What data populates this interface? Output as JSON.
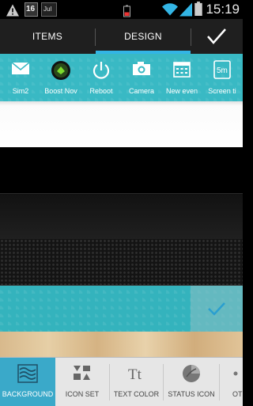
{
  "status_bar": {
    "date_day": "16",
    "date_month": "Jul",
    "time": "15:19",
    "icons": [
      "warning-icon",
      "calendar-icon",
      "battery-low-icon",
      "wifi-icon",
      "signal-icon",
      "battery-icon"
    ]
  },
  "tabs": [
    {
      "label": "ITEMS",
      "selected": false
    },
    {
      "label": "DESIGN",
      "selected": true
    }
  ],
  "confirm_icon": "checkmark-icon",
  "toggles": [
    {
      "label": "Sim2",
      "icon": "mail-icon"
    },
    {
      "label": "Boost Nov",
      "icon": "boost-icon"
    },
    {
      "label": "Reboot",
      "icon": "power-icon"
    },
    {
      "label": "Camera",
      "icon": "camera-icon"
    },
    {
      "label": "New even",
      "icon": "calendar-icon"
    },
    {
      "label": "Screen ti",
      "icon": "screen-timeout-icon"
    }
  ],
  "backgrounds": [
    {
      "name": "white"
    },
    {
      "name": "black"
    },
    {
      "name": "dark-gradient"
    },
    {
      "name": "carbon-mesh"
    },
    {
      "name": "teal-pattern",
      "selected": true
    },
    {
      "name": "wood"
    }
  ],
  "bottom_tabs": [
    {
      "label": "BACKGROUND",
      "icon": "background-icon",
      "selected": true
    },
    {
      "label": "ICON SET",
      "icon": "icon-set-icon",
      "selected": false
    },
    {
      "label": "TEXT COLOR",
      "icon": "text-color-icon",
      "selected": false
    },
    {
      "label": "STATUS ICON",
      "icon": "status-icon-icon",
      "selected": false
    },
    {
      "label": "OT",
      "icon": "other-icon",
      "selected": false
    }
  ],
  "colors": {
    "accent": "#33b5e5",
    "teal": "#39b9c4",
    "selected_tab": "#3aa9c9"
  }
}
